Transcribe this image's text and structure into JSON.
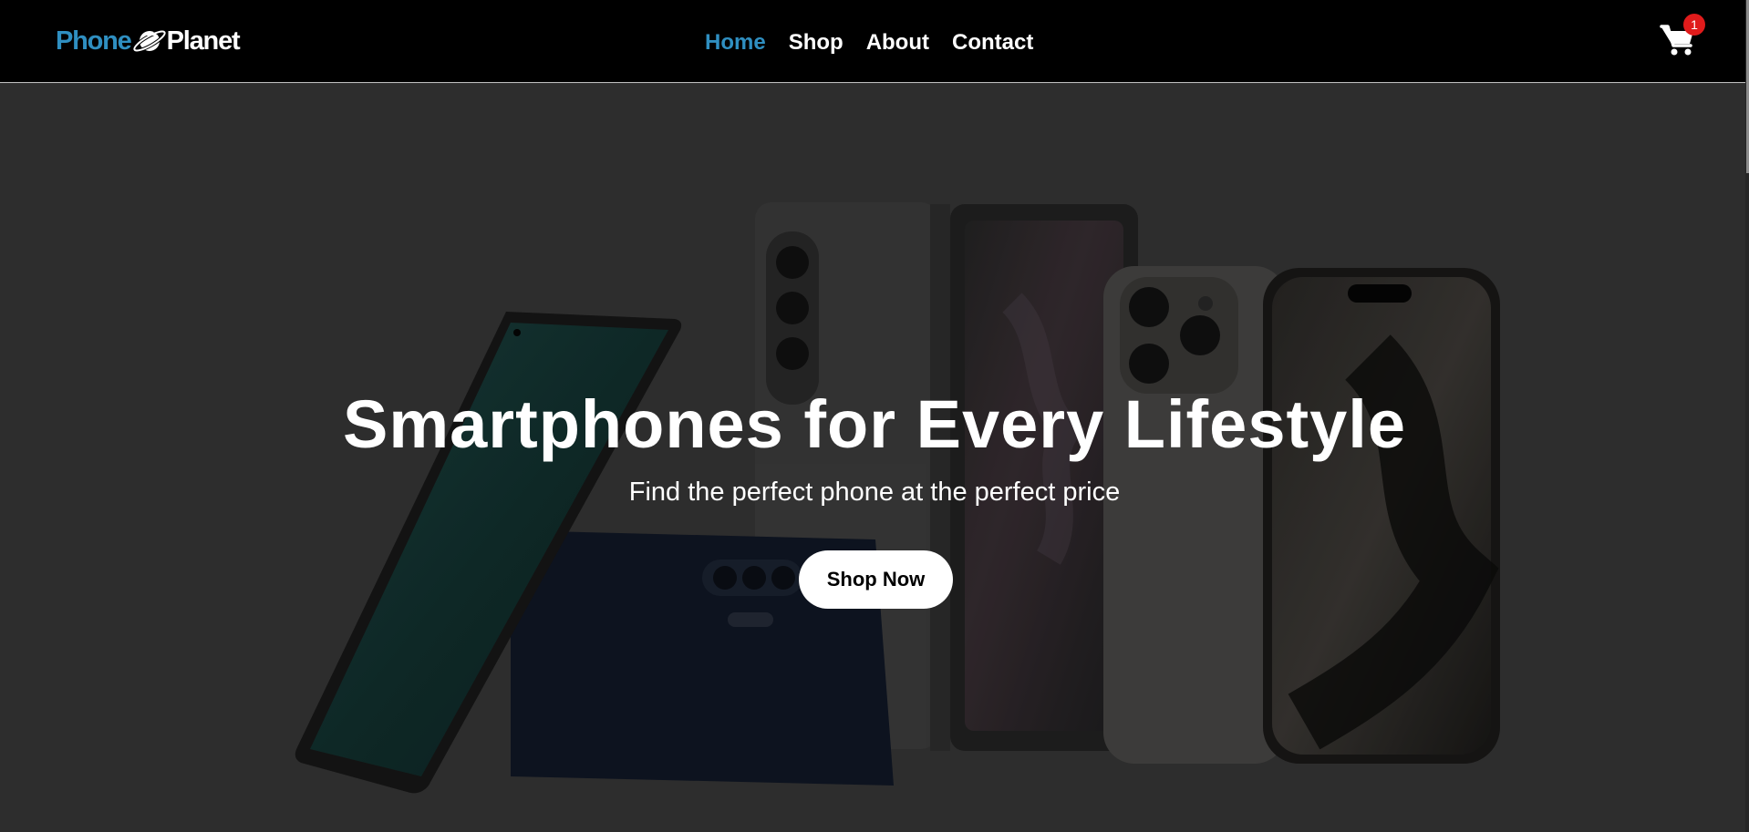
{
  "brand": {
    "name_part1": "Phone",
    "name_part2": "Planet",
    "accent_color": "#2f8fc1"
  },
  "nav": {
    "items": [
      {
        "label": "Home",
        "active": true
      },
      {
        "label": "Shop",
        "active": false
      },
      {
        "label": "About",
        "active": false
      },
      {
        "label": "Contact",
        "active": false
      }
    ]
  },
  "cart": {
    "icon": "shopping-cart-icon",
    "count": "1",
    "badge_color": "#e01b1b"
  },
  "hero": {
    "title": "Smartphones for Every Lifestyle",
    "subtitle": "Find the perfect phone at the perfect price",
    "cta_label": "Shop Now",
    "image": "smartphones-lineup-image"
  }
}
